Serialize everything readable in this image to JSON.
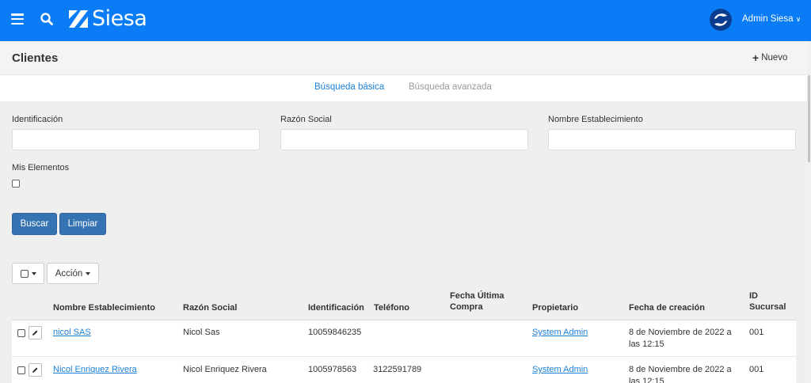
{
  "app": {
    "brand": "Siesa",
    "user": "Admin Siesa"
  },
  "header": {
    "title": "Clientes",
    "new_label": "Nuevo"
  },
  "tabs": [
    {
      "label": "Búsqueda básica",
      "active": true
    },
    {
      "label": "Búsqueda avanzada",
      "active": false
    }
  ],
  "filters": {
    "identificacion_label": "Identificación",
    "razon_label": "Razón Social",
    "nombre_label": "Nombre Establecimiento",
    "mis_label": "Mis Elementos",
    "buscar": "Buscar",
    "limpiar": "Limpiar"
  },
  "toolbar": {
    "accion": "Acción"
  },
  "table": {
    "columns": [
      "Nombre Establecimiento",
      "Razón Social",
      "Identificación",
      "Teléfono",
      "Fecha Última Compra",
      "Propietario",
      "Fecha de creación",
      "ID Sucursal"
    ],
    "rows": [
      {
        "nombre": "nicol SAS",
        "razon": "Nicol Sas",
        "identificacion": "10059846235",
        "telefono": "",
        "fecha_compra": "",
        "propietario": "System Admin",
        "fecha_creacion": "8 de Noviembre de 2022 a las 12:15",
        "sucursal": "001"
      },
      {
        "nombre": "Nicol Enriquez Rivera",
        "razon": "Nicol Enriquez Rivera",
        "identificacion": "1005978563",
        "telefono": "3122591789",
        "fecha_compra": "",
        "propietario": "System Admin",
        "fecha_creacion": "8 de Noviembre de 2022 a las 12:15",
        "sucursal": "001"
      }
    ]
  },
  "colors": {
    "primary": "#0a7cf6",
    "button": "#3673b3",
    "link": "#1a7fd8"
  }
}
